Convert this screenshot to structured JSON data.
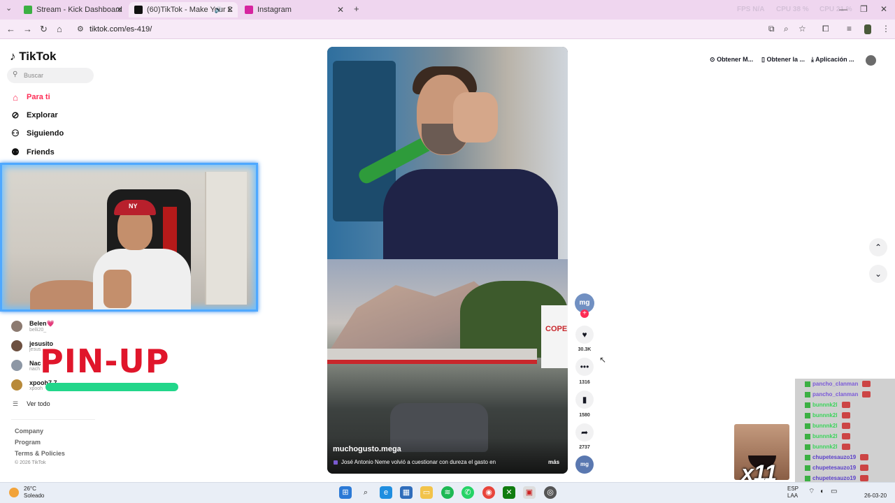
{
  "browser": {
    "tabs": [
      {
        "label": "Stream - Kick Dashboard",
        "favicon_color": "#3cb043"
      },
      {
        "label": "(60)TikTok - Make Your Day",
        "favicon_color": "#111111"
      },
      {
        "label": "Instagram",
        "favicon_color": "#d6249f"
      }
    ],
    "overlay_stats": [
      "FPS N/A",
      "CPU 38 %",
      "CPU 21 %"
    ],
    "url": "tiktok.com/es-419/"
  },
  "tiktok": {
    "logo": "TikTok",
    "search_placeholder": "Buscar",
    "nav": [
      {
        "label": "Para ti",
        "icon": "home-icon"
      },
      {
        "label": "Explorar",
        "icon": "compass-icon"
      },
      {
        "label": "Siguiendo",
        "icon": "following-icon"
      },
      {
        "label": "Friends",
        "icon": "friends-icon"
      }
    ],
    "accounts": [
      {
        "name": "Belen💗",
        "handle": "belli20_",
        "color": "#8c7a70"
      },
      {
        "name": "jesusito",
        "handle": "jesus",
        "color": "#6d5040"
      },
      {
        "name": "Nac",
        "handle": "nach",
        "color": "#8d97a5"
      },
      {
        "name": "xpooh7 7",
        "handle": "xpooh",
        "color": "#b88a3a"
      }
    ],
    "see_all": "Ver todo",
    "footer": [
      "Company",
      "Program",
      "Terms & Policies"
    ],
    "copyright": "© 2026 TikTok",
    "top_links": [
      "Obtener M...",
      "Obtener la ...",
      "Aplicación ..."
    ]
  },
  "sponsor": {
    "text": "PIN-UP"
  },
  "webcam": {
    "cap_text": "NY"
  },
  "video": {
    "author": "muchogusto.mega",
    "caption": "José Antonio Neme volvió a cuestionar con dureza el gasto en",
    "more": "más",
    "copec_sign": "COPE",
    "channel_avatar": "mg",
    "likes": "30.3K",
    "comments": "1316",
    "saves": "1580",
    "shares": "2737"
  },
  "chat": {
    "users": [
      "pancho_clanman",
      "pancho_clanman",
      "bunnnk2l",
      "bunnnk2l",
      "bunnnk2l",
      "bunnnk2l",
      "bunnnk2l",
      "chupetesauzo19",
      "chupetesauzo19",
      "chupetesauzo19"
    ],
    "meme_text": "x11"
  },
  "taskbar": {
    "temp": "26°C",
    "weather": "Soleado",
    "lang": "ESP",
    "lang2": "LAA",
    "date": "26-03-20"
  }
}
